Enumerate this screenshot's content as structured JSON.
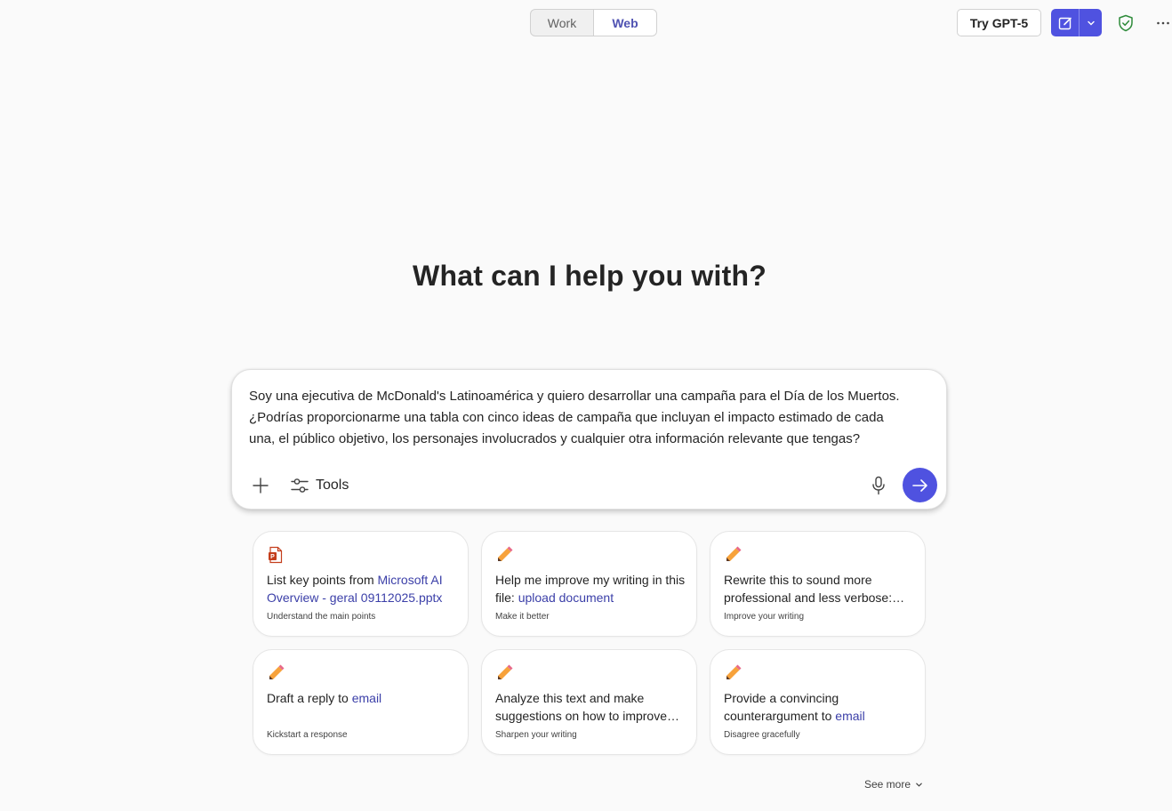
{
  "header": {
    "mode_tabs": [
      {
        "label": "Work",
        "active": false
      },
      {
        "label": "Web",
        "active": true
      }
    ],
    "try_button": "Try GPT-5"
  },
  "main": {
    "headline": "What can I help you with?"
  },
  "composer": {
    "lines": [
      "Soy una ejecutiva de McDonald's Latinoamérica y quiero desarrollar una campaña para el Día de los Muertos.",
      "¿Podrías proporcionarme una tabla con cinco ideas de campaña que incluyan el impacto estimado de cada",
      "una, el público objetivo, los personajes involucrados y cualquier otra información relevante que tengas?"
    ],
    "tools_label": "Tools"
  },
  "suggestions": [
    {
      "icon": "powerpoint-file-icon",
      "text": "List key points from ",
      "link": "Microsoft AI Overview - geral 09112025.pptx",
      "suffix": "",
      "sub": "Understand the main points"
    },
    {
      "icon": "pencil-icon",
      "text": "Help me improve my writing in this file: ",
      "link": "upload document",
      "suffix": "",
      "sub": "Make it better"
    },
    {
      "icon": "pencil-icon",
      "text": "Rewrite this to sound more professional and less verbose:…",
      "link": "",
      "suffix": "",
      "sub": "Improve your writing"
    },
    {
      "icon": "pencil-icon",
      "text": "Draft a reply to ",
      "link": "email",
      "suffix": "",
      "sub": "Kickstart a response"
    },
    {
      "icon": "pencil-icon",
      "text": "Analyze this text and make suggestions on how to improve…",
      "link": "",
      "suffix": "",
      "sub": "Sharpen your writing"
    },
    {
      "icon": "pencil-icon",
      "text": "Provide a convincing counterargument to ",
      "link": "email",
      "suffix": "",
      "sub": "Disagree gracefully"
    }
  ],
  "see_more": "See more",
  "colors": {
    "accent": "#4f52e0",
    "link": "#3b3fa8",
    "shield_green": "#2e8b3a"
  }
}
